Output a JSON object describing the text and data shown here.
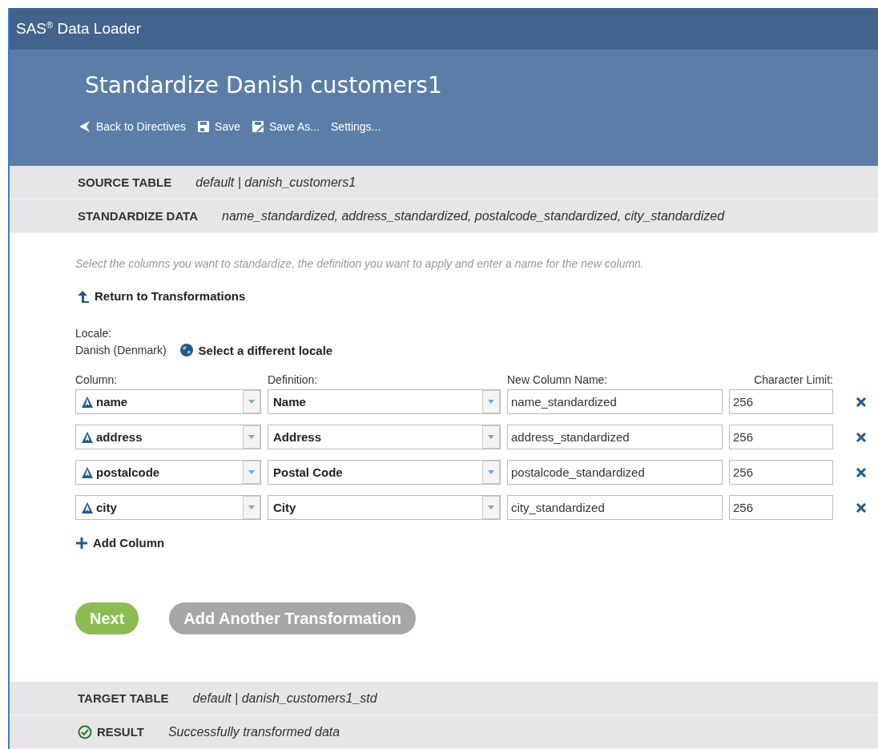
{
  "app_bar": {
    "title": "SAS$^{®}$ Data Loader"
  },
  "header": {
    "title": "Standardize Danish customers1",
    "toolbar": [
      {
        "kind": "back",
        "label": "Back to Directives"
      },
      {
        "kind": "save",
        "label": "Save"
      },
      {
        "kind": "save_as",
        "label": "Save As..."
      },
      {
        "kind": "plain",
        "label": "Settings..."
      }
    ]
  },
  "summary_top": [
    {
      "kind": "plain",
      "label": "SOURCE TABLE",
      "value": "default | danish_customers1"
    },
    {
      "kind": "plain",
      "label": "STANDARDIZE DATA",
      "value": "name_standardized, address_standardized, postalcode_standardized, city_standardized"
    }
  ],
  "instructions": "Select the columns you want to standardize, the definition you want to apply and enter a name for the new column.",
  "return_link": "Return to Transformations",
  "locale": {
    "label": "Locale:",
    "value": "Danish (Denmark)",
    "change_link": "Select a different locale"
  },
  "columns": [
    "Column:",
    "Definition:",
    "New Column Name:",
    "Character Limit:"
  ],
  "rows": [
    {
      "column": "name",
      "definition": "Name",
      "new_name": "name_standardized",
      "limit": "256"
    },
    {
      "column": "address",
      "definition": "Address",
      "new_name": "address_standardized",
      "limit": "256"
    },
    {
      "column": "postalcode",
      "definition": "Postal Code",
      "new_name": "postalcode_standardized",
      "limit": "256"
    },
    {
      "column": "city",
      "definition": "City",
      "new_name": "city_standardized",
      "limit": "256"
    }
  ],
  "add_column": "Add Column",
  "buttons": [
    {
      "kind": "primary",
      "label": "Next"
    },
    {
      "kind": "secondary",
      "label": "Add Another Transformation"
    }
  ],
  "summary_bottom": [
    {
      "kind": "plain",
      "label": "TARGET TABLE",
      "value": "default | danish_customers1_std"
    },
    {
      "kind": "success",
      "label": "RESULT",
      "value": "Successfully transformed data"
    }
  ]
}
